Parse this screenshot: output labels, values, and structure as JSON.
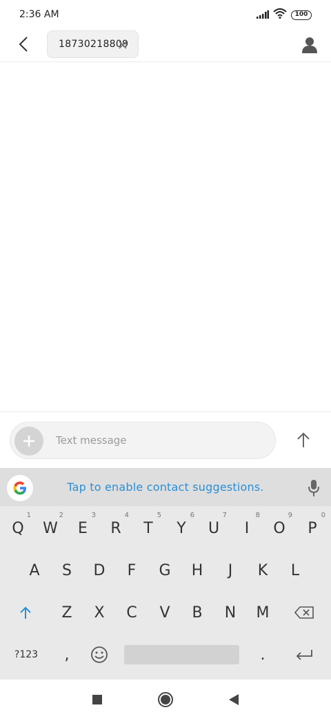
{
  "status_bar": {
    "time": "2:36 AM",
    "battery": "100"
  },
  "header": {
    "recipient": "18730218809"
  },
  "compose": {
    "placeholder": "Text message"
  },
  "keyboard": {
    "suggestion": "Tap to enable contact suggestions.",
    "row1": [
      {
        "label": "Q",
        "hint": "1"
      },
      {
        "label": "W",
        "hint": "2"
      },
      {
        "label": "E",
        "hint": "3"
      },
      {
        "label": "R",
        "hint": "4"
      },
      {
        "label": "T",
        "hint": "5"
      },
      {
        "label": "Y",
        "hint": "6"
      },
      {
        "label": "U",
        "hint": "7"
      },
      {
        "label": "I",
        "hint": "8"
      },
      {
        "label": "O",
        "hint": "9"
      },
      {
        "label": "P",
        "hint": "0"
      }
    ],
    "row2": [
      "A",
      "S",
      "D",
      "F",
      "G",
      "H",
      "J",
      "K",
      "L"
    ],
    "row3": [
      "Z",
      "X",
      "C",
      "V",
      "B",
      "N",
      "M"
    ],
    "row4": {
      "symbols": "?123",
      "comma": ",",
      "period": "."
    }
  },
  "colors": {
    "accent": "#2a8fd6",
    "keyboard_bg": "#e9e9e9"
  }
}
